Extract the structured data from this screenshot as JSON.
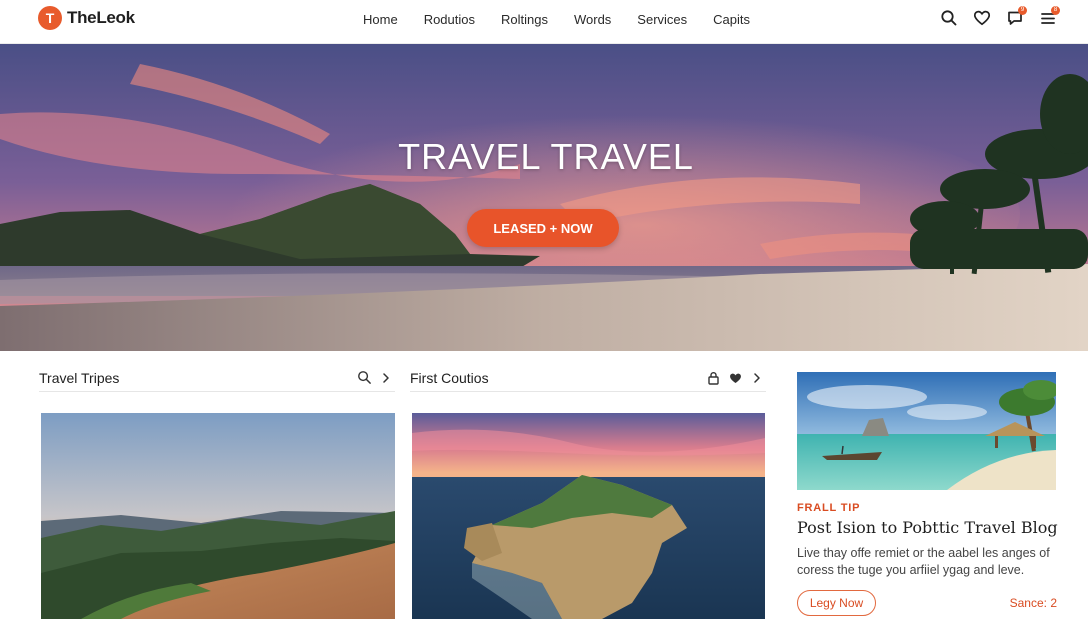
{
  "brand": {
    "logo_letter": "T",
    "name": "TheLeok",
    "accent": "#e8542a"
  },
  "nav": {
    "items": [
      "Home",
      "Rodutios",
      "Roltings",
      "Words",
      "Services",
      "Capits"
    ]
  },
  "header_icons": {
    "icons": [
      "search-icon",
      "heart-icon",
      "chat-icon",
      "menu-icon"
    ],
    "chat_badge": "9",
    "menu_badge": "8"
  },
  "hero": {
    "title": "TRAVEL TRAVEL",
    "cta_label": "LEASED + NOW"
  },
  "cards": [
    {
      "title": "Travel Tripes",
      "icons": [
        "search-icon",
        "chevron-right-icon"
      ]
    },
    {
      "title": "First Coutios",
      "icons": [
        "lock-icon",
        "heart-icon",
        "chevron-right-icon"
      ]
    }
  ],
  "blog": {
    "tag": "FRALL TIP",
    "title": "Post Ision to Pobttic Travel Blog",
    "excerpt": "Live thay offe remiet or the aabel les anges of coress the tuge you arfiiel ygag and leve.",
    "button_label": "Legy Now",
    "meta": "Sance: 2"
  }
}
